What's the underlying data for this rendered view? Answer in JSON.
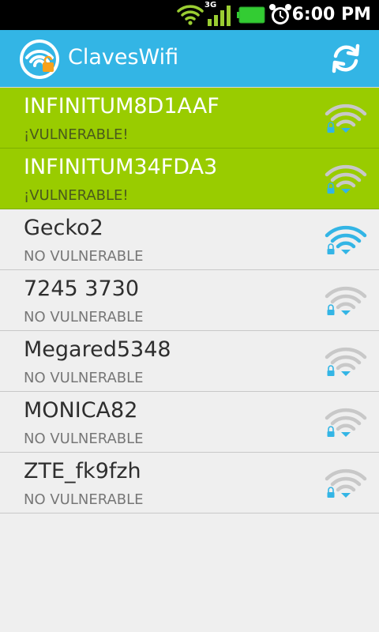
{
  "status_bar": {
    "time": "6:00 PM",
    "network_type": "3G",
    "icons": [
      "wifi-icon",
      "signal-icon",
      "battery-icon",
      "alarm-icon"
    ]
  },
  "app_bar": {
    "title": "ClavesWifi",
    "logo_icon": "wifi-lock-logo",
    "refresh_icon": "refresh-icon"
  },
  "colors": {
    "accent": "#33b5e5",
    "vulnerable": "#99cc00",
    "signal_strong": "#33b5e5",
    "signal_weak": "#c8c8c8",
    "background": "#efefef"
  },
  "networks": [
    {
      "ssid": "INFINITUM8D1AAF",
      "status": "¡VULNERABLE!",
      "vulnerable": true,
      "strength": "weak"
    },
    {
      "ssid": "INFINITUM34FDA3",
      "status": "¡VULNERABLE!",
      "vulnerable": true,
      "strength": "weak"
    },
    {
      "ssid": "Gecko2",
      "status": "NO VULNERABLE",
      "vulnerable": false,
      "strength": "strong"
    },
    {
      "ssid": "7245 3730",
      "status": "NO VULNERABLE",
      "vulnerable": false,
      "strength": "weak"
    },
    {
      "ssid": "Megared5348",
      "status": "NO VULNERABLE",
      "vulnerable": false,
      "strength": "weak"
    },
    {
      "ssid": "MONICA82",
      "status": "NO VULNERABLE",
      "vulnerable": false,
      "strength": "weak"
    },
    {
      "ssid": "ZTE_fk9fzh",
      "status": "NO VULNERABLE",
      "vulnerable": false,
      "strength": "weak"
    }
  ]
}
